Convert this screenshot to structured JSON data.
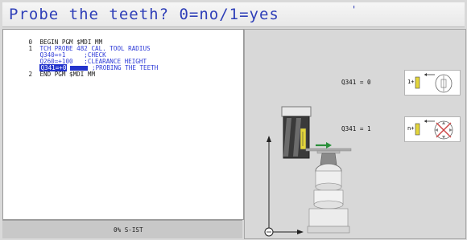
{
  "dialog": {
    "prompt": "Probe the teeth? 0=no/1=yes",
    "title_mark": "'"
  },
  "program": {
    "lines": [
      {
        "num": "0",
        "text": "BEGIN PGM $MDI MM",
        "blue": false
      },
      {
        "num": "1",
        "text": "TCH PROBE 482 CAL. TOOL RADIUS",
        "blue": true
      },
      {
        "num": "",
        "text": "Q340=+1     ;CHECK",
        "blue": true
      },
      {
        "num": "",
        "text": "Q260=+100   ;CLEARANCE HEIGHT",
        "blue": true
      },
      {
        "num": "",
        "selected_value": "Q341=+0",
        "text": ";PROBING THE TEETH",
        "blue": true,
        "selected": true
      },
      {
        "num": "2",
        "text": "END PGM $MDI MM",
        "blue": false
      }
    ]
  },
  "status": {
    "text": "0% S-IST"
  },
  "help_graphic": {
    "option_0": {
      "label": "Q341 = 0",
      "card_text": "1+"
    },
    "option_1": {
      "label": "Q341 = 1",
      "card_text": "n+"
    }
  },
  "colors": {
    "prompt_blue": "#2f3fb8",
    "program_blue": "#2e3bd8",
    "selection_blue": "#2233cc",
    "tool_yellow": "#e4d63a",
    "arrow_green": "#2a8f3a"
  }
}
